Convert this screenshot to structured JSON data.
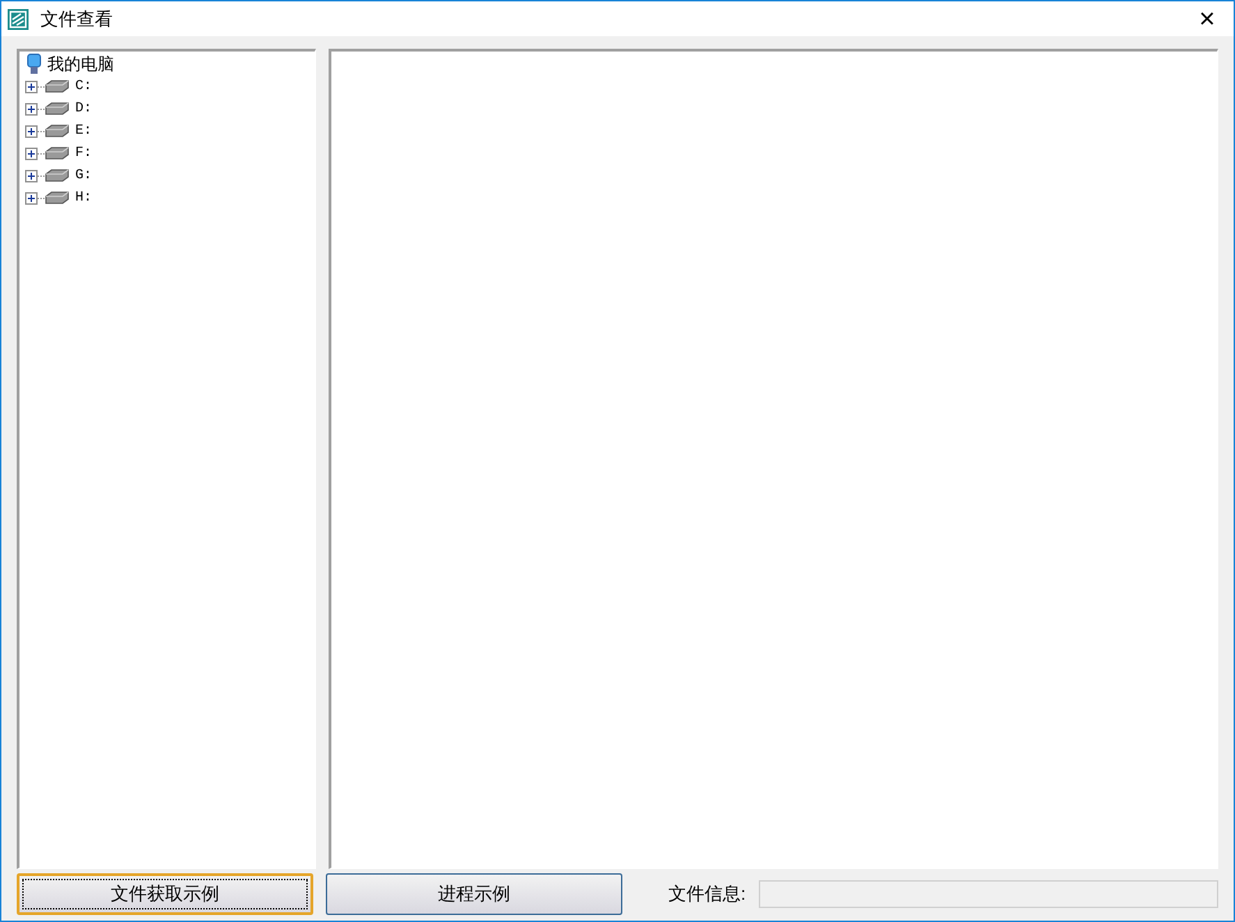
{
  "window": {
    "title": "文件查看",
    "close": "×"
  },
  "tree": {
    "label": "我的电脑",
    "children": [
      {
        "label": "C:",
        "expanded": false
      },
      {
        "label": "D:",
        "expanded": false
      },
      {
        "label": "E:",
        "expanded": false
      },
      {
        "label": "F:",
        "expanded": false
      },
      {
        "label": "G:",
        "expanded": false
      },
      {
        "label": "H:",
        "expanded": false
      }
    ]
  },
  "buttons": [
    {
      "label": "文件获取示例",
      "focused": true
    },
    {
      "label": "进程示例",
      "focused": false
    }
  ],
  "file_info": {
    "label": "文件信息:"
  }
}
